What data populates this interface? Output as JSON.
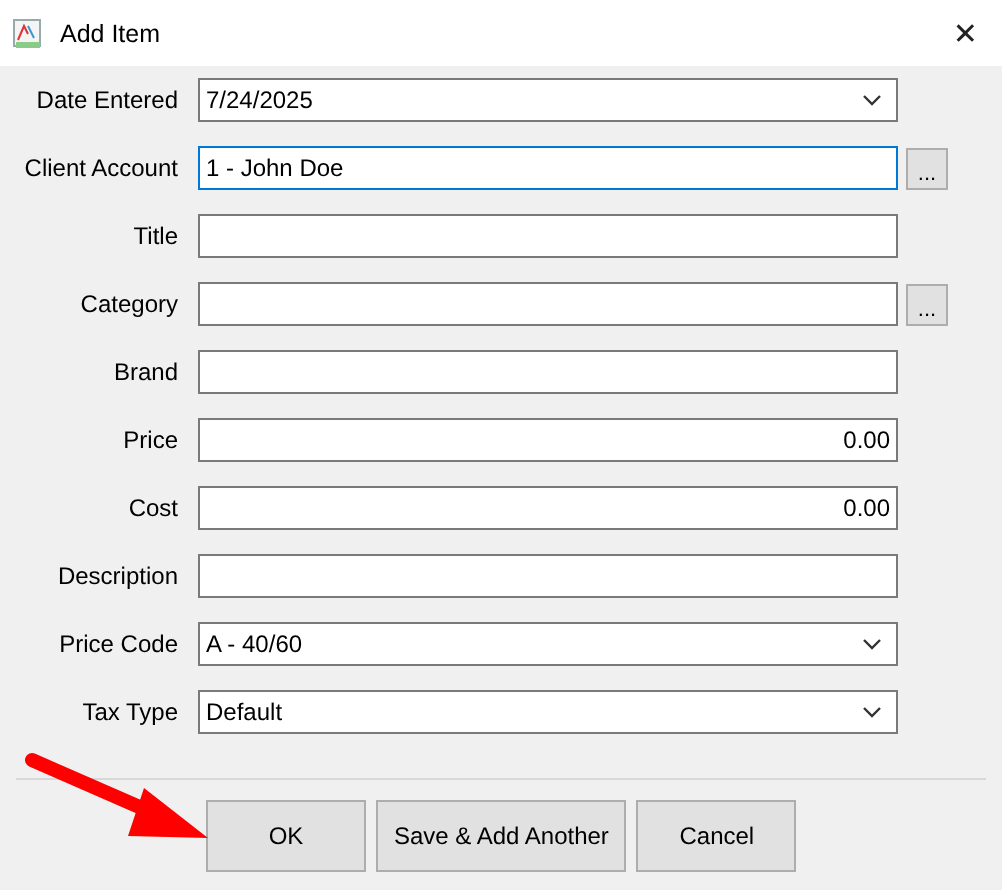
{
  "window": {
    "title": "Add Item",
    "close": "✕"
  },
  "fields": [
    {
      "label": "Date Entered",
      "kind": "dropdown",
      "value": "7/24/2025",
      "focused": false
    },
    {
      "label": "Client Account",
      "kind": "text",
      "value": "1 - John Doe",
      "focused": true,
      "browse_button": "..."
    },
    {
      "label": "Title",
      "kind": "text",
      "focused": false
    },
    {
      "label": "Category",
      "kind": "text",
      "focused": false,
      "browse_button": "..."
    },
    {
      "label": "Brand",
      "kind": "text",
      "focused": false
    },
    {
      "label": "Price",
      "kind": "number",
      "value": "0.00",
      "focused": false
    },
    {
      "label": "Cost",
      "kind": "number",
      "value": "0.00",
      "focused": false
    },
    {
      "label": "Description",
      "kind": "text",
      "focused": false
    },
    {
      "label": "Price Code",
      "kind": "dropdown",
      "value": "A - 40/60",
      "focused": false
    },
    {
      "label": "Tax Type",
      "kind": "dropdown",
      "value": "Default",
      "focused": false
    }
  ],
  "buttons": [
    "OK",
    "Save & Add Another",
    "Cancel"
  ]
}
